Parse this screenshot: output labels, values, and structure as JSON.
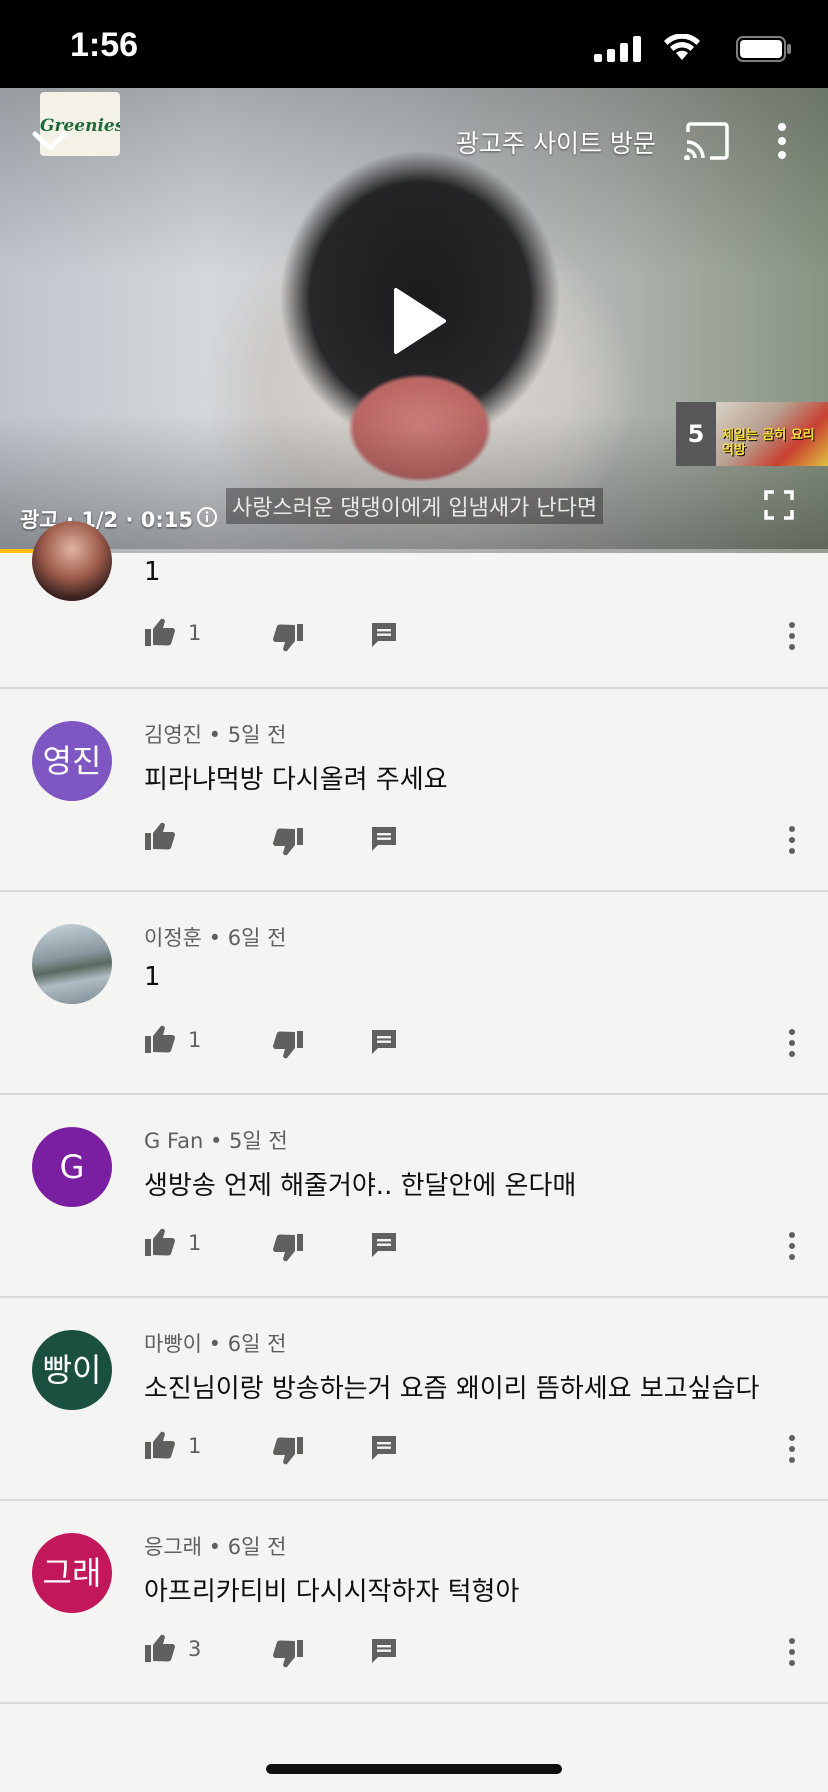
{
  "status_bar": {
    "time": "1:56"
  },
  "player": {
    "advertiser_logo": "Greenies",
    "visit_advertiser": "광고주 사이트 방문",
    "ad_info": "광고 · 1/2 · 0:15",
    "subtitle": "사랑스러운 댕댕이에게 입냄새가 난다면",
    "next_count": "5",
    "next_thumbnail_text": "제일는 곰히 요리 먹방",
    "progress_fraction": 0.04,
    "progress_color": "#fdbc0f"
  },
  "comments": [
    {
      "author": "",
      "time": "",
      "text": "1",
      "likes": "1",
      "avatar_text": "",
      "avatar_color": "#b98472"
    },
    {
      "author": "김영진",
      "time": "5일 전",
      "text": "피라냐먹방 다시올려 주세요",
      "likes": "",
      "avatar_text": "영진",
      "avatar_color": "#7e57c2"
    },
    {
      "author": "이정훈",
      "time": "6일 전",
      "text": "1",
      "likes": "1",
      "avatar_text": "",
      "avatar_color": "#7d8a8c"
    },
    {
      "author": "G Fan",
      "time": "5일 전",
      "text": "생방송 언제 해줄거야.. 한달안에 온다매",
      "likes": "1",
      "avatar_text": "G",
      "avatar_color": "#7b1fa2"
    },
    {
      "author": "마빵이",
      "time": "6일 전",
      "text": "소진님이랑 방송하는거 요즘 왜이리 뜸하세요 보고싶습다",
      "likes": "1",
      "avatar_text": "빵이",
      "avatar_color": "#1b4f3f"
    },
    {
      "author": "응그래",
      "time": "6일 전",
      "text": "아프리카티비 다시시작하자 턱형아",
      "likes": "3",
      "avatar_text": "그래",
      "avatar_color": "#c2185b"
    }
  ],
  "icons": {
    "collapse": "chevron-down-icon",
    "cast": "cast-icon",
    "more": "more-vert-icon",
    "play": "play-icon",
    "info": "info-icon",
    "fullscreen": "fullscreen-icon",
    "like": "thumb-up-icon",
    "dislike": "thumb-down-icon",
    "reply": "reply-icon"
  }
}
